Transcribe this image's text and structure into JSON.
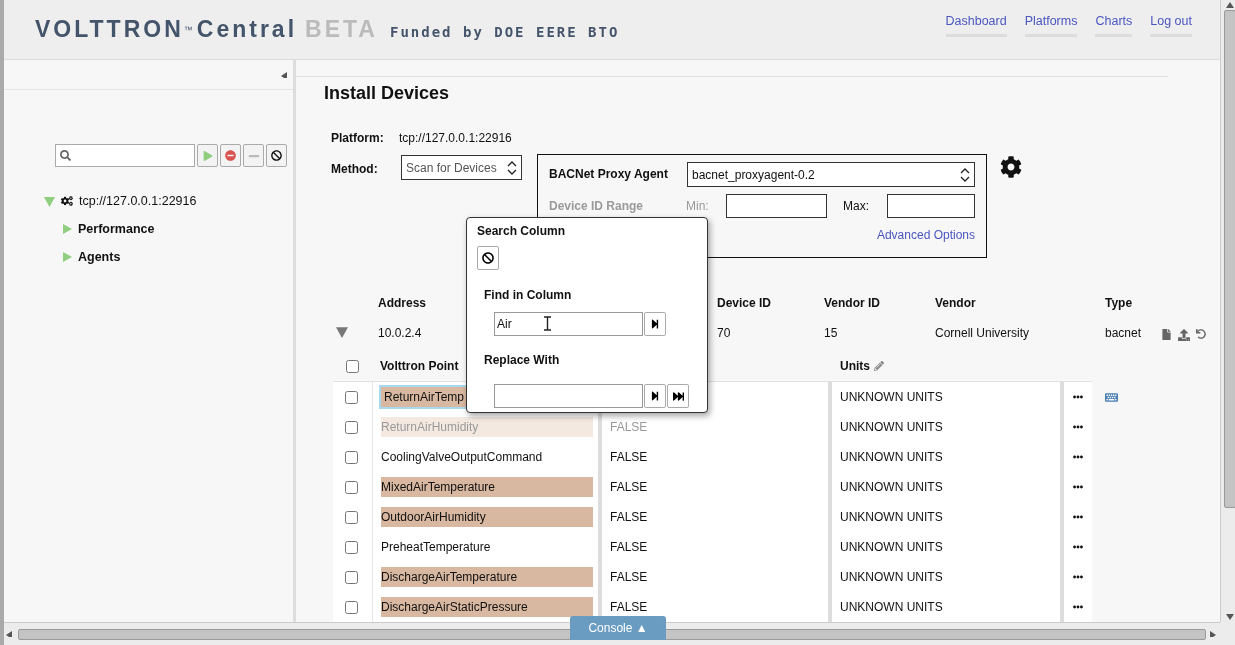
{
  "header": {
    "logo": "VOLTTRON",
    "trademark": "™",
    "product": "Central",
    "badge": "BETA",
    "funding": "Funded by DOE EERE BTO",
    "nav": [
      {
        "label": "Dashboard"
      },
      {
        "label": "Platforms"
      },
      {
        "label": "Charts"
      },
      {
        "label": "Log out"
      }
    ]
  },
  "sidebar": {
    "tree": [
      {
        "label": "tcp://127.0.0.1:22916",
        "expanded": true,
        "children": [
          {
            "label": "Performance",
            "expanded": false
          },
          {
            "label": "Agents",
            "expanded": false
          }
        ]
      }
    ]
  },
  "main": {
    "title": "Install Devices",
    "platform": {
      "label": "Platform:",
      "value": "tcp://127.0.0.1:22916"
    },
    "method": {
      "label": "Method:",
      "value": "Scan for Devices"
    },
    "bacnet": {
      "label": "BACNet Proxy Agent",
      "value": "bacnet_proxyagent-0.2",
      "range_label": "Device ID Range",
      "min_label": "Min:",
      "max_label": "Max:",
      "link": "Advanced Options"
    }
  },
  "devices": {
    "columns": [
      "Address",
      "Device ID",
      "Vendor ID",
      "Vendor",
      "Type"
    ],
    "rows": [
      {
        "expanded": true,
        "cells": [
          "10.0.2.4",
          "70",
          "15",
          "Cornell University",
          "bacnet"
        ]
      }
    ]
  },
  "points": {
    "all_checked": false,
    "name_column": "Volttron Point",
    "units_column": "Units",
    "rows": [
      {
        "checked": false,
        "name": "ReturnAirTemp",
        "units": "UNKNOWN UNITS",
        "highlighted": true,
        "faded": false,
        "active": true
      },
      {
        "checked": false,
        "name": "ReturnAirHumidity",
        "value": "FALSE",
        "units": "UNKNOWN UNITS",
        "highlighted": true,
        "faded": true,
        "active": false
      },
      {
        "checked": false,
        "name": "CoolingValveOutputCommand",
        "value": "FALSE",
        "units": "UNKNOWN UNITS",
        "highlighted": false,
        "faded": false,
        "active": false
      },
      {
        "checked": false,
        "name": "MixedAirTemperature",
        "value": "FALSE",
        "units": "UNKNOWN UNITS",
        "highlighted": true,
        "faded": false,
        "active": false
      },
      {
        "checked": false,
        "name": "OutdoorAirHumidity",
        "value": "FALSE",
        "units": "UNKNOWN UNITS",
        "highlighted": true,
        "faded": false,
        "active": false
      },
      {
        "checked": false,
        "name": "PreheatTemperature",
        "value": "FALSE",
        "units": "UNKNOWN UNITS",
        "highlighted": false,
        "faded": false,
        "active": false
      },
      {
        "checked": false,
        "name": "DischargeAirTemperature",
        "value": "FALSE",
        "units": "UNKNOWN UNITS",
        "highlighted": true,
        "faded": false,
        "active": false
      },
      {
        "checked": false,
        "name": "DischargeAirStaticPressure",
        "value": "FALSE",
        "units": "UNKNOWN UNITS",
        "highlighted": true,
        "faded": false,
        "active": false
      }
    ]
  },
  "find_panel": {
    "title": "Search Column",
    "find_label": "Find in Column",
    "find_value": "Air",
    "replace_label": "Replace With"
  },
  "console": {
    "label": "Console ▲"
  }
}
